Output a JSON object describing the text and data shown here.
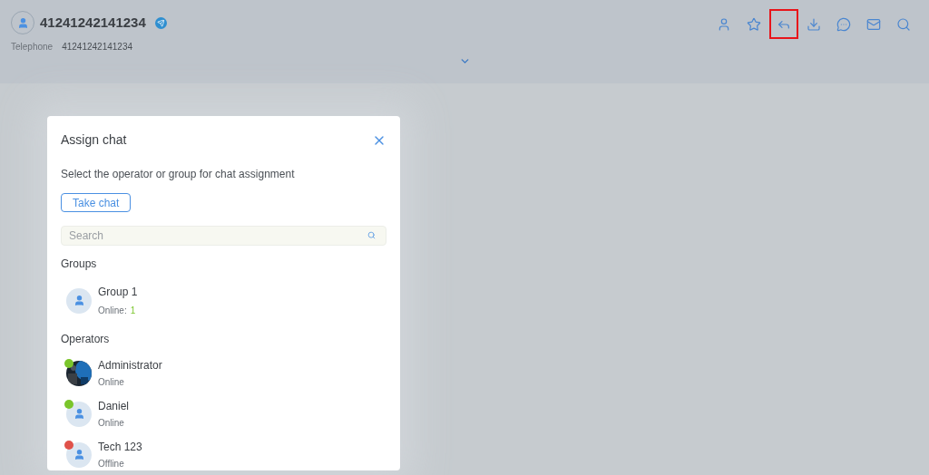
{
  "contact": {
    "name": "41241242141234",
    "field_label": "Telephone",
    "field_value": "41241242141234"
  },
  "toolbar": [
    {
      "kind": "user",
      "highlighted": false
    },
    {
      "kind": "star",
      "highlighted": false
    },
    {
      "kind": "reply",
      "highlighted": true
    },
    {
      "kind": "download",
      "highlighted": false
    },
    {
      "kind": "chat",
      "highlighted": false
    },
    {
      "kind": "mail",
      "highlighted": false
    },
    {
      "kind": "search",
      "highlighted": false
    }
  ],
  "dialog": {
    "title": "Assign chat",
    "description": "Select the operator or group for chat assignment",
    "take_button": "Take chat",
    "search": {
      "placeholder": "Search"
    },
    "groups_heading": "Groups",
    "groups": [
      {
        "name": "Group 1",
        "online_label": "Online:",
        "online_count": "1"
      }
    ],
    "operators_heading": "Operators",
    "operators": [
      {
        "name": "Administrator",
        "status": "Online",
        "color": "#7ac52b"
      },
      {
        "name": "Daniel",
        "status": "Online",
        "color": "#7ac52b",
        "kind": "default"
      },
      {
        "name": "Tech 123",
        "status": "Offline",
        "color": "#e0524a",
        "kind": "default"
      }
    ]
  }
}
